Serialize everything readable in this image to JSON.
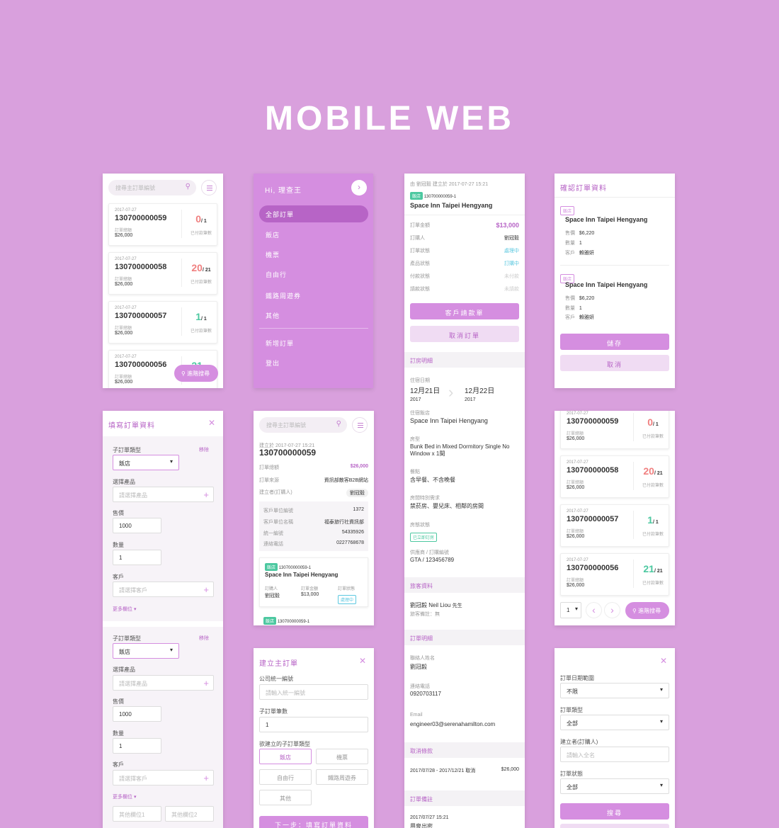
{
  "page_title": "MOBILE WEB",
  "search_placeholder": "搜尋主訂單編號",
  "orders": [
    {
      "date": "2017-07-27",
      "number": "130700000059",
      "amount_label": "訂單總額",
      "amount": "$26,000",
      "paid": "0",
      "total": "/ 1",
      "paid_label": "已付款筆數"
    },
    {
      "date": "2017-07-27",
      "number": "130700000058",
      "amount_label": "訂單總額",
      "amount": "$26,000",
      "paid": "20",
      "total": "/ 21",
      "paid_label": "已付款筆數"
    },
    {
      "date": "2017-07-27",
      "number": "130700000057",
      "amount_label": "訂單總額",
      "amount": "$26,000",
      "paid": "1",
      "total": "/ 1",
      "paid_label": "已付款筆數"
    },
    {
      "date": "2017-07-27",
      "number": "130700000056",
      "amount_label": "訂單總額",
      "amount": "$26,000",
      "paid": "21",
      "total": "/ 21",
      "paid_label": "已付款筆數"
    }
  ],
  "advanced_search_label": "進階搜尋",
  "menu": {
    "greeting": "Hi, 理查王",
    "items": [
      "全部訂單",
      "飯店",
      "機票",
      "自由行",
      "鐵路周遊券",
      "其他"
    ],
    "items2": [
      "新增訂單",
      "登出"
    ]
  },
  "detail": {
    "meta": "由 劉冠毅 建立於 2017-07-27 15:21",
    "tag": "飯店",
    "sub_no": "130700000059-1",
    "hotel": "Space Inn Taipei Hengyang",
    "rows": [
      {
        "label": "訂單金額",
        "value": "$13,000"
      },
      {
        "label": "訂購人",
        "value": "劉冠毅"
      },
      {
        "label": "訂單狀態",
        "value": "處理中"
      },
      {
        "label": "產品狀態",
        "value": "訂購中"
      },
      {
        "label": "付款狀態",
        "value": "未付款"
      },
      {
        "label": "請款狀態",
        "value": "未請款"
      }
    ],
    "btn_request": "客戶請款單",
    "btn_cancel": "取消訂單",
    "sec_room": "訂房明細",
    "checkin_label": "住宿日期",
    "checkin": "12月21日",
    "checkin_year": "2017",
    "checkout": "12月22日",
    "checkout_year": "2017",
    "hotel_label": "住宿飯店",
    "hotel_name": "Space Inn Taipei Hengyang",
    "room_label": "房型",
    "room_value": "Bunk Bed in Mixed Dormitory Single No Window x 1間",
    "meal_label": "餐點",
    "meal_value": "含早餐、不含晚餐",
    "special_label": "房間特別需求",
    "special_value": "禁菸房、嬰兒床、相鄰的房間",
    "room_status_label": "房態狀態",
    "room_status_value": "已立即訂房",
    "supplier_label": "供應商 / 訂購編號",
    "supplier_value": "GTA / 123456789",
    "sec_guest": "旅客資料",
    "guest_name": "劉冠毅 Neil Liou",
    "guest_title": "先生",
    "guest_note": "旅客備註：無",
    "sec_order": "訂單明細",
    "contact_label": "聯絡人姓名",
    "contact_value": "劉冠毅",
    "phone_label": "連絡電話",
    "phone_value": "0920703117",
    "email_label": "Email",
    "email_value": "engineer03@serenahamilton.com",
    "sec_cancel": "取消條款",
    "cancel_range": "2017/07/28 - 2017/12/21 取消",
    "cancel_fee": "$26,000",
    "sec_note": "訂單備註",
    "note_date": "2017/07/27 15:21",
    "note_text": "用泉出密"
  },
  "confirm": {
    "title": "確認訂單資料",
    "items": [
      {
        "tag": "飯店",
        "hotel": "Space Inn Taipei Hengyang",
        "price_label": "售價",
        "price": "$6,220",
        "qty_label": "數量",
        "qty": "1",
        "cust_label": "客戶",
        "cust": "賴雅妍"
      },
      {
        "tag": "飯店",
        "hotel": "Space Inn Taipei Hengyang",
        "price_label": "售價",
        "price": "$6,220",
        "qty_label": "數量",
        "qty": "1",
        "cust_label": "客戶",
        "cust": "賴雅妍"
      }
    ],
    "save": "儲存",
    "cancel": "取消"
  },
  "fill": {
    "title": "填寫訂單資料",
    "type_label": "子訂單類型",
    "remove": "移除",
    "type_value": "飯店",
    "product_label": "選擇產品",
    "product_ph": "請選擇產品",
    "price_label": "售價",
    "price_value": "1000",
    "qty_label": "數量",
    "qty_value": "1",
    "cust_label": "客戶",
    "cust_ph": "請選擇客戶",
    "more": "更多欄位",
    "other1": "其他欄位1",
    "other2": "其他欄位2"
  },
  "main_detail": {
    "created": "建立於 2017-07-27 15:21",
    "number": "130700000059",
    "rows": [
      {
        "label": "訂單總額",
        "value": "$26,000"
      },
      {
        "label": "訂單來源",
        "value": "資訊部散客B2B網站"
      },
      {
        "label": "建立者(訂購人)",
        "value": "劉冠毅"
      }
    ],
    "info": [
      {
        "label": "客戶單位編號",
        "value": "1372"
      },
      {
        "label": "客戶單位名稱",
        "value": "福泰旅行社資訊部"
      },
      {
        "label": "統一編號",
        "value": "54335926"
      },
      {
        "label": "連絡電話",
        "value": "0227768678"
      }
    ],
    "sub": {
      "tag": "飯店",
      "no": "130700000059-1",
      "hotel": "Space Inn Taipei Hengyang",
      "l1": "訂購人",
      "v1": "劉冠毅",
      "l2": "訂單金額",
      "v2": "$13,000",
      "l3": "訂單狀態",
      "v3": "處理中"
    },
    "sub2_no": "130700000059-1"
  },
  "create": {
    "title": "建立主訂單",
    "tax_label": "公司統一編號",
    "tax_ph": "請輸入統一編號",
    "count_label": "子訂單筆數",
    "count_value": "1",
    "type_label": "欲建立的子訂單類型",
    "types": [
      "飯店",
      "機票",
      "自由行",
      "鐵路周遊券",
      "其他"
    ],
    "next": "下一步：填寫訂單資料"
  },
  "pager": {
    "page": "1"
  },
  "filter": {
    "date_label": "訂單日期範圍",
    "date_value": "不限",
    "type_label": "訂單類型",
    "type_value": "全部",
    "creator_label": "建立者(訂購人)",
    "creator_ph": "請輸入全名",
    "status_label": "訂單狀態",
    "status_value": "全部",
    "search": "搜尋"
  },
  "colors": {
    "bg": "#d9a0dd",
    "accent": "#d58ee0",
    "accent_dark": "#b764c6",
    "red": "#f08080",
    "green": "#4cc8a0"
  }
}
